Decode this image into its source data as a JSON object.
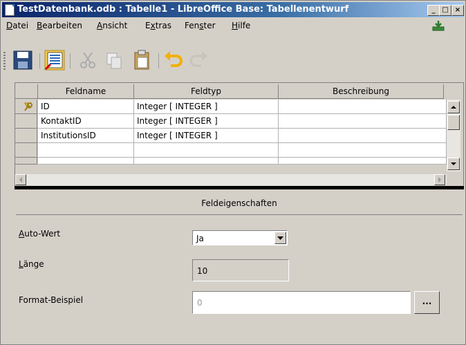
{
  "window": {
    "title": "TestDatenbank.odb : Tabelle1 - LibreOffice Base: Tabellenentwurf",
    "controls": {
      "minimize": "_",
      "maximize": "□",
      "close": "×"
    }
  },
  "menu": [
    {
      "pre": "",
      "u": "D",
      "post": "atei"
    },
    {
      "pre": "",
      "u": "B",
      "post": "earbeiten"
    },
    {
      "pre": "",
      "u": "A",
      "post": "nsicht"
    },
    {
      "pre": "E",
      "u": "x",
      "post": "tras"
    },
    {
      "pre": "Fen",
      "u": "s",
      "post": "ter"
    },
    {
      "pre": "",
      "u": "H",
      "post": "ilfe"
    }
  ],
  "toolbar": [
    "save-icon",
    "index-design-icon",
    "cut-icon",
    "copy-icon",
    "paste-icon",
    "undo-icon",
    "redo-icon"
  ],
  "grid": {
    "columns": [
      "Feldname",
      "Feldtyp",
      "Beschreibung"
    ],
    "rows": [
      {
        "name": "ID",
        "type": "Integer [ INTEGER ]",
        "desc": "",
        "primary_key": true
      },
      {
        "name": "KontaktID",
        "type": "Integer [ INTEGER ]",
        "desc": ""
      },
      {
        "name": "InstitutionsID",
        "type": "Integer [ INTEGER ]",
        "desc": ""
      },
      {
        "name": "",
        "type": "",
        "desc": ""
      }
    ]
  },
  "properties": {
    "title": "Feldeigenschaften",
    "autowert": {
      "u": "A",
      "post": "uto-Wert",
      "value": "Ja"
    },
    "laenge": {
      "u": "L",
      "post": "änge",
      "value": "10"
    },
    "format": {
      "label": "Format-Beispiel",
      "value": "0",
      "button": "..."
    }
  }
}
